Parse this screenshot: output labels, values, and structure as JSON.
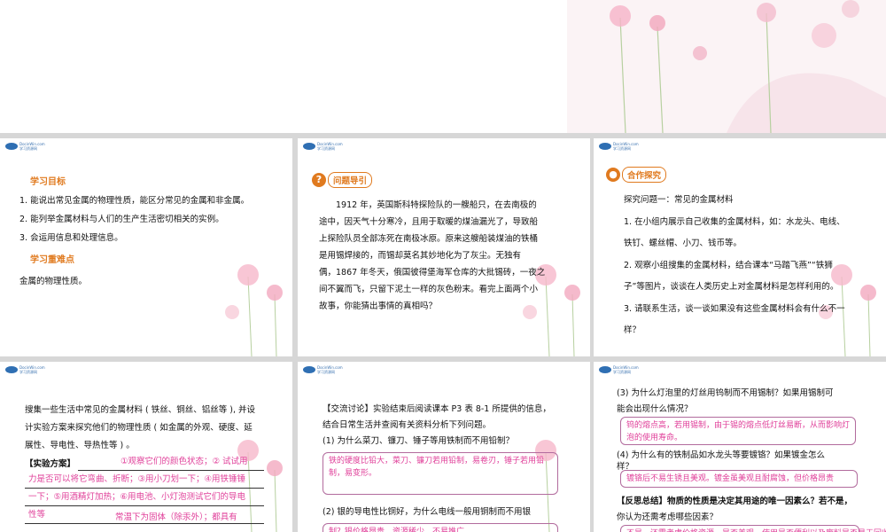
{
  "logo": {
    "text1": "DocinWin.com",
    "text2": "学习资源网"
  },
  "slide1": {
    "heading1": "学习目标",
    "goals": [
      "1. 能说出常见金属的物理性质，能区分常见的金属和非金属。",
      "2. 能列举金属材料与人们的生产生活密切相关的实例。",
      "3. 会运用信息和处理信息。"
    ],
    "heading2": "学习重难点",
    "key": "金属的物理性质。"
  },
  "slide2": {
    "badge": "问题导引",
    "lines": [
      "1912 年，英国斯科特探险队的一艘船只，在去南极的",
      "途中，因天气十分寒冷，且用于取暖的煤油漏光了，导致船",
      "上探险队员全部冻死在南极冰原。原来这艘船装煤油的铁桶",
      "是用锡焊接的，而锡却莫名其妙地化为了灰尘。无独有",
      "偶，1867 年冬天，俄国彼得堡海军仓库的大批锡砖，一夜之",
      "间不翼而飞，只留下泥土一样的灰色粉末。看完上面两个小",
      "故事，你能猜出事情的真相吗？"
    ]
  },
  "slide3": {
    "badge": "合作探究",
    "lines": [
      "探究问题一：常见的金属材料",
      "1. 在小组内展示自己收集的金属材料，如：水龙头、电线、",
      "铁钉、螺丝帽、小刀、钱币等。",
      "2. 观察小组搜集的金属材料，结合课本“马踏飞燕”“铁狮",
      "子”等图片，谈谈在人类历史上对金属材料是怎样利用的。",
      "3. 请联系生活，谈一谈如果没有这些金属材料会有什么不一",
      "样？"
    ]
  },
  "slide4": {
    "lines": [
      "搜集一些生活中常见的金属材料 ( 铁丝、铜丝、铝丝等 ), 并设",
      "计实验方案来探究他们的物理性质 ( 如金属的外观、硬度、延",
      "展性、导电性、导热性等 ) 。"
    ],
    "plan_label": "【实验方案】",
    "plan": [
      "①观察它们的颜色状态；② 试试用",
      "力是否可以将它弯曲、折断；③用小刀划一下；④用铁锤锤",
      "一下；⑤用酒精灯加热；⑥用电池、小灯泡测试它们的导电",
      "性等",
      "常温下为固体（除汞外）；都具有"
    ]
  },
  "slide5": {
    "lines": [
      "【交流讨论】实验结束后阅读课本 P3 表 8-1 所提供的信息，",
      "结合日常生活并查阅有关资料分析下列问题。",
      "(1) 为什么菜刀、镰刀、锤子等用铁制而不用铅制？"
    ],
    "answer1": "铁的硬度比铅大，菜刀、镰刀若用铅制，易卷刃，锤子若用铅制，易变形。",
    "q2": "(2) 银的导电性比铜好，为什么电线一般用铜制而不用银",
    "answer2": "制？银价格昂贵，资源稀少，不易推广"
  },
  "slide6": {
    "q3": [
      "(3) 为什么灯泡里的灯丝用钨制而不用锡制？如果用锡制可",
      "能会出现什么情况？"
    ],
    "answer3": "钨的熔点高，若用锡制，由于锡的熔点低灯丝易断，从而影响灯泡的使用寿命。",
    "q4": [
      "(4) 为什么有的铁制品如水龙头等要镀铬？如果镀金怎么",
      "样？"
    ],
    "answer4": "镀铬后不易生锈且美观。镀金虽美观且耐腐蚀，但价格昂贵",
    "reflect": [
      "【反思总结】物质的性质是决定其用途的唯一因素么？若不是，",
      "你认为还需考虑哪些因素？"
    ],
    "answer5": "不是，还需考虑价格资源、是否美观、使用是否便利以及废料是否易于回收"
  }
}
